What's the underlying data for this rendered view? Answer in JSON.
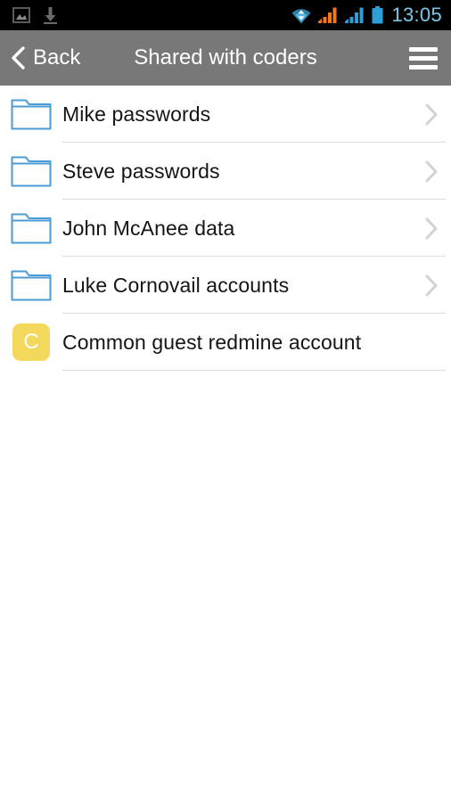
{
  "statusbar": {
    "time": "13:05",
    "left_icons": [
      {
        "name": "gallery-icon"
      },
      {
        "name": "download-icon"
      }
    ],
    "right_icons": [
      {
        "name": "wifi-icon"
      },
      {
        "name": "signal-bars-orange-icon"
      },
      {
        "name": "signal-bars-blue-icon"
      },
      {
        "name": "battery-icon"
      }
    ],
    "colors": {
      "background": "#000000",
      "time_text": "#79c8e8",
      "wifi": "#3aa6d8",
      "signal_orange": "#f07818",
      "signal_blue": "#2e9fd6",
      "battery": "#2e9fd6",
      "left_icon": "#5a5a5a"
    }
  },
  "header": {
    "back_label": "Back",
    "title": "Shared with coders",
    "back_icon": "chevron-left-icon",
    "menu_icon": "hamburger-menu-icon",
    "colors": {
      "background": "#787878",
      "text": "#ffffff"
    }
  },
  "list": {
    "items": [
      {
        "label": "Mike passwords",
        "icon": "folder-icon",
        "icon_type": "folder",
        "has_chevron": true
      },
      {
        "label": "Steve passwords",
        "icon": "folder-icon",
        "icon_type": "folder",
        "has_chevron": true
      },
      {
        "label": "John McAnee data",
        "icon": "folder-icon",
        "icon_type": "folder",
        "has_chevron": true
      },
      {
        "label": "Luke Cornovail accounts",
        "icon": "folder-icon",
        "icon_type": "folder",
        "has_chevron": true
      },
      {
        "label": "Common guest redmine account",
        "icon": "avatar-letter-icon",
        "icon_type": "avatar",
        "avatar_letter": "C",
        "has_chevron": false
      }
    ],
    "colors": {
      "row_background": "#ffffff",
      "label_text": "#151515",
      "divider": "#dcdcdc",
      "folder_outline": "#4a9bd8",
      "avatar_background": "#f3d85c",
      "avatar_text": "#ffffff",
      "chevron": "#d2d2d2"
    }
  }
}
